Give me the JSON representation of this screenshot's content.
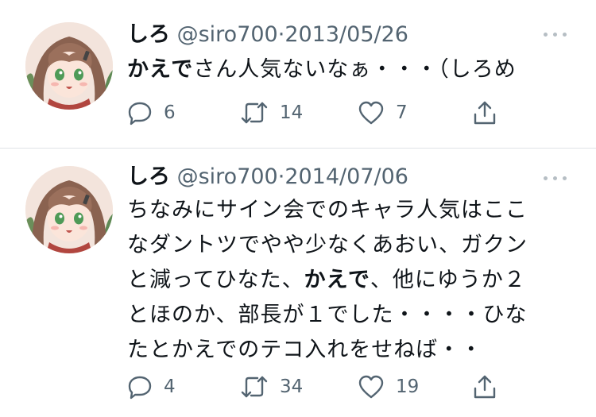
{
  "tweets": [
    {
      "display_name": "しろ",
      "handle": "@siro700",
      "separator": "·",
      "date": "2013/05/26",
      "text_lines": [
        [
          {
            "text": "かえで",
            "bold": true
          },
          {
            "text": "さん人気ないなぁ・・・（しろめ",
            "bold": false
          }
        ]
      ],
      "replies": "6",
      "retweets": "14",
      "likes": "7"
    },
    {
      "display_name": "しろ",
      "handle": "@siro700",
      "separator": "·",
      "date": "2014/07/06",
      "text_lines": [
        [
          {
            "text": "ちなみにサイン会でのキャラ人気はここ",
            "bold": false
          }
        ],
        [
          {
            "text": "なダントツでやや少なくあおい、ガクン",
            "bold": false
          }
        ],
        [
          {
            "text": "と減ってひなた、",
            "bold": false
          },
          {
            "text": "かえで",
            "bold": true
          },
          {
            "text": "、他にゆうか２",
            "bold": false
          }
        ],
        [
          {
            "text": "とほのか、部長が１でした・・・・ひな",
            "bold": false
          }
        ],
        [
          {
            "text": "たとかえでのテコ入れをせねば・・",
            "bold": false
          }
        ]
      ],
      "replies": "4",
      "retweets": "34",
      "likes": "19"
    }
  ],
  "icons": [
    "more-icon",
    "reply-icon",
    "retweet-icon",
    "like-icon",
    "share-icon"
  ],
  "colors": {
    "text": "#0f1419",
    "secondary": "#536471",
    "divider": "#dfe3e6",
    "more_dots": "#b6bec4"
  }
}
